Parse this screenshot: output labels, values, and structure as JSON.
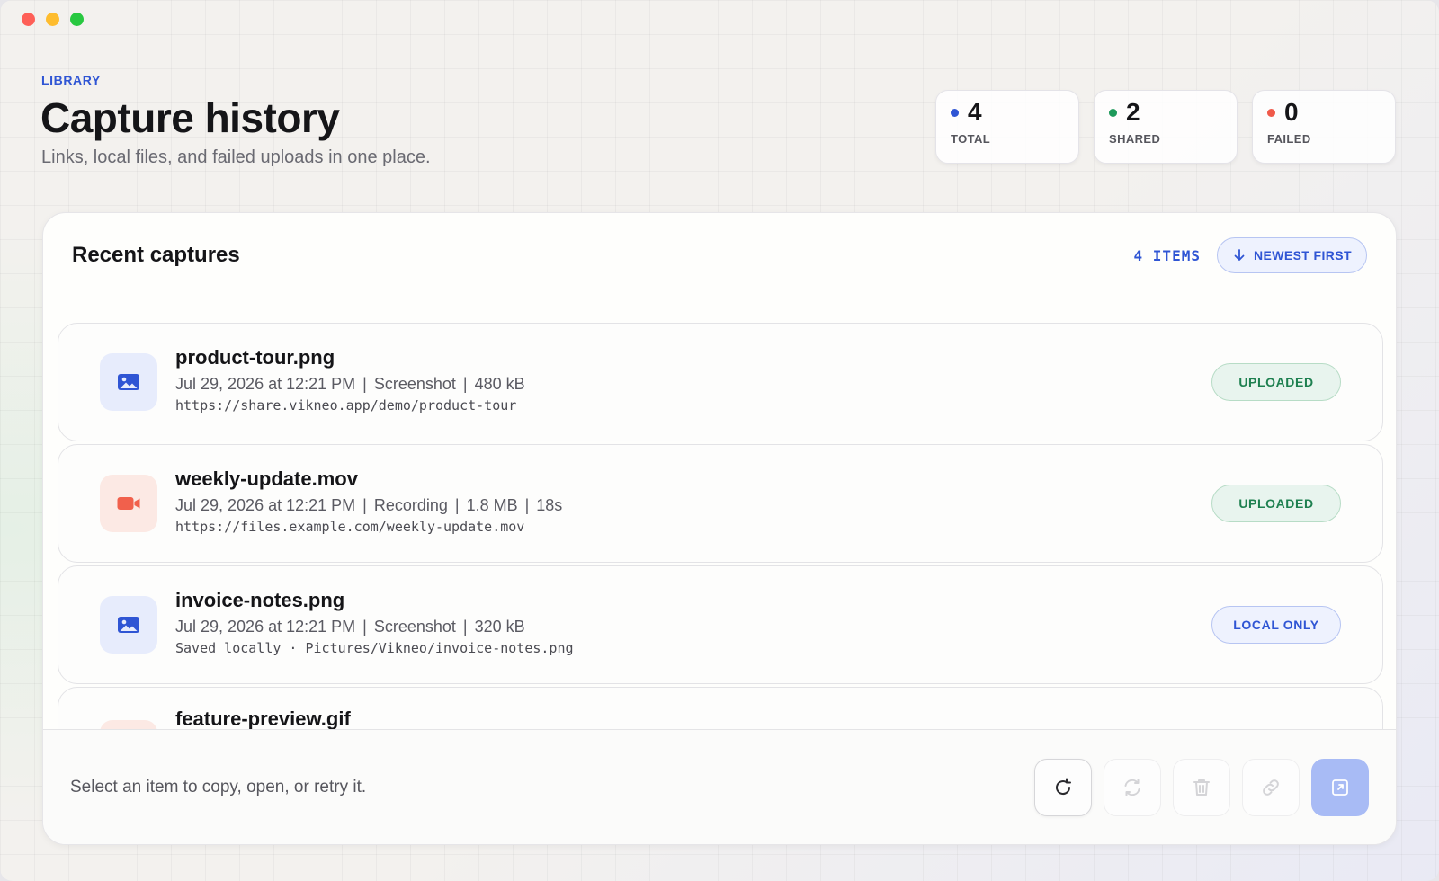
{
  "window": {
    "controls": [
      "close",
      "minimize",
      "zoom"
    ]
  },
  "header": {
    "eyebrow": "LIBRARY",
    "title": "Capture history",
    "subtitle": "Links, local files, and failed uploads in one place."
  },
  "stats": [
    {
      "value": "4",
      "label": "TOTAL",
      "color": "#2f55d4"
    },
    {
      "value": "2",
      "label": "SHARED",
      "color": "#1e9a5b"
    },
    {
      "value": "0",
      "label": "FAILED",
      "color": "#f05a4a"
    }
  ],
  "panel": {
    "title": "Recent captures",
    "items_count": "4 ITEMS",
    "sort_label": "NEWEST FIRST",
    "sort_icon": "arrow-down-icon"
  },
  "captures": [
    {
      "name": "product-tour.png",
      "date": "Jul 29, 2026 at 12:21 PM",
      "kind": "Screenshot",
      "size": "480 kB",
      "link": "https://share.vikneo.app/demo/product-tour",
      "status": "UPLOADED",
      "icon": "image-icon"
    },
    {
      "name": "weekly-update.mov",
      "date": "Jul 29, 2026 at 12:21 PM",
      "kind": "Recording",
      "size": "1.8 MB",
      "duration": "18s",
      "link": "https://files.example.com/weekly-update.mov",
      "status": "UPLOADED",
      "icon": "video-icon"
    },
    {
      "name": "invoice-notes.png",
      "date": "Jul 29, 2026 at 12:21 PM",
      "kind": "Screenshot",
      "size": "320 kB",
      "link": "Saved locally · Pictures/Vikneo/invoice-notes.png",
      "status": "LOCAL ONLY",
      "icon": "image-icon"
    },
    {
      "name": "feature-preview.gif",
      "icon": "video-icon"
    }
  ],
  "footer": {
    "hint": "Select an item to copy, open, or retry it.",
    "actions": [
      "refresh-icon",
      "retry-icon",
      "trash-icon",
      "link-icon",
      "open-external-icon"
    ]
  },
  "colors": {
    "accent": "#2f55d4",
    "success": "#1e8050",
    "danger": "#f05a4a"
  }
}
